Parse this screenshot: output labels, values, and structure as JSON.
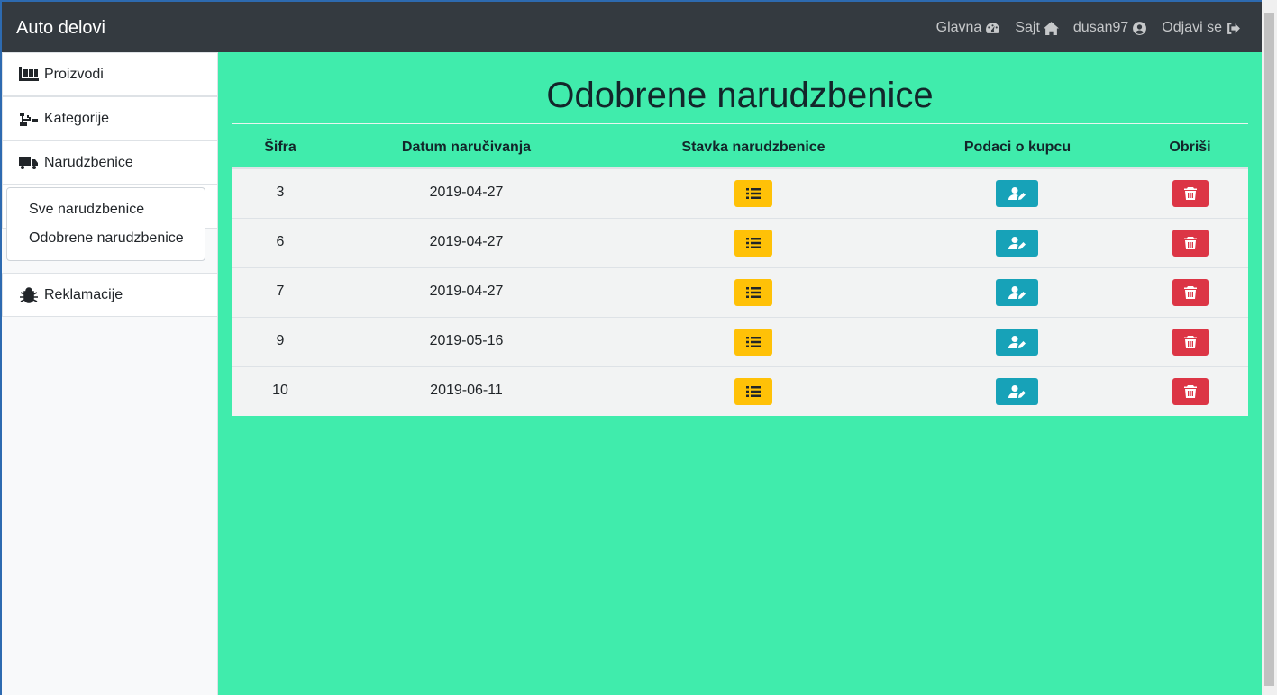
{
  "navbar": {
    "brand": "Auto delovi",
    "links": [
      {
        "label": "Glavna",
        "icon": "tachometer-icon"
      },
      {
        "label": "Sajt",
        "icon": "home-icon"
      },
      {
        "label": "dusan97",
        "icon": "user-circle-icon"
      },
      {
        "label": "Odjavi se",
        "icon": "sign-out-icon"
      }
    ]
  },
  "sidebar": {
    "items": [
      {
        "label": "Proizvodi",
        "icon": "pallet-icon"
      },
      {
        "label": "Kategorije",
        "icon": "sitemap-icon"
      },
      {
        "label": "Narudzbenice",
        "icon": "truck-icon"
      },
      {
        "label": "Reklamacije",
        "icon": "bug-icon"
      }
    ],
    "dropdown": [
      "Sve narudzbenice",
      "Odobrene narudzbenice"
    ]
  },
  "main": {
    "title": "Odobrene narudzbenice",
    "columns": [
      "Šifra",
      "Datum naručivanja",
      "Stavka narudzbenice",
      "Podaci o kupcu",
      "Obriši"
    ],
    "rows": [
      {
        "id": "3",
        "date": "2019-04-27"
      },
      {
        "id": "6",
        "date": "2019-04-27"
      },
      {
        "id": "7",
        "date": "2019-04-27"
      },
      {
        "id": "9",
        "date": "2019-05-16"
      },
      {
        "id": "10",
        "date": "2019-06-11"
      }
    ],
    "row_buttons": {
      "items_icon": "list-icon",
      "customer_icon": "user-edit-icon",
      "delete_icon": "trash-icon"
    }
  },
  "colors": {
    "navbar": "#343a40",
    "main_bg": "#40ecac",
    "btn_warning": "#ffc107",
    "btn_info": "#17a2b8",
    "btn_danger": "#dc3545"
  }
}
